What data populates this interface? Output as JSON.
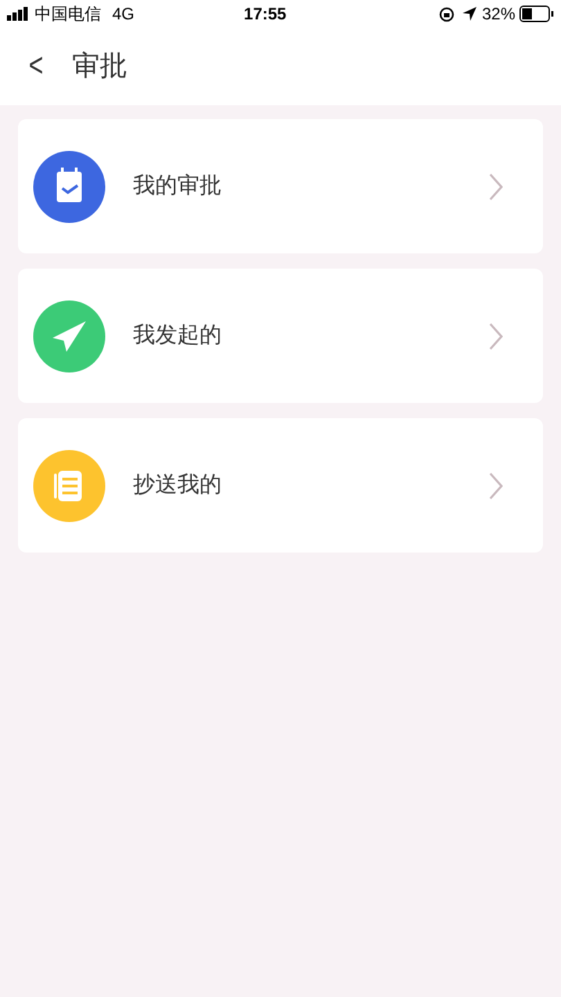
{
  "status_bar": {
    "carrier": "中国电信",
    "network": "4G",
    "time": "17:55",
    "battery": "32%"
  },
  "header": {
    "back": "<",
    "title": "审批"
  },
  "items": [
    {
      "label": "我的审批",
      "kind": "calendar",
      "color": "#3d67e0"
    },
    {
      "label": "我发起的",
      "kind": "send",
      "color": "#3ccb77"
    },
    {
      "label": "抄送我的",
      "kind": "notebook",
      "color": "#fdc32e"
    }
  ]
}
